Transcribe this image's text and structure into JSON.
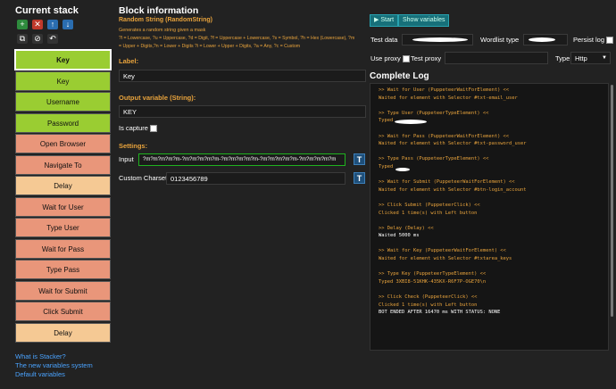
{
  "stack": {
    "title": "Current stack",
    "toolbar": [
      {
        "name": "add-icon",
        "glyph": "+",
        "color": "#2e8b3d"
      },
      {
        "name": "delete-icon",
        "glyph": "✕",
        "color": "#c0392b"
      },
      {
        "name": "move-up-icon",
        "glyph": "↑",
        "color": "#2a6db0"
      },
      {
        "name": "move-down-icon",
        "glyph": "↓",
        "color": "#2a6db0"
      },
      {
        "name": "copy-icon",
        "glyph": "⧉",
        "color": "#333"
      },
      {
        "name": "disable-icon",
        "glyph": "⊘",
        "color": "#333"
      },
      {
        "name": "undo-icon",
        "glyph": "↶",
        "color": "#333"
      }
    ],
    "items": [
      {
        "label": "Key",
        "color": "green",
        "selected": true
      },
      {
        "label": "Key",
        "color": "green"
      },
      {
        "label": "Username",
        "color": "green"
      },
      {
        "label": "Password",
        "color": "green"
      },
      {
        "label": "Open Browser",
        "color": "salmon"
      },
      {
        "label": "Navigate To",
        "color": "salmon"
      },
      {
        "label": "Delay",
        "color": "peach"
      },
      {
        "label": "Wait for User",
        "color": "salmon"
      },
      {
        "label": "Type User",
        "color": "salmon"
      },
      {
        "label": "Wait for Pass",
        "color": "salmon"
      },
      {
        "label": "Type Pass",
        "color": "salmon"
      },
      {
        "label": "Wait for Submit",
        "color": "salmon"
      },
      {
        "label": "Click Submit",
        "color": "salmon"
      },
      {
        "label": "Delay",
        "color": "peach"
      }
    ],
    "links": [
      "What is Stacker?",
      "The new variables system",
      "Default variables"
    ]
  },
  "block": {
    "title": "Block information",
    "subtitle": "Random String (RandomString)",
    "desc1": "Generates a random string given a mask",
    "desc2": "?l = Lowercase, ?u = Uppercase, ?d = Digit, ?f = Uppercase + Lowercase, ?s = Symbol, ?h = Hex (Lowercase), ?m",
    "desc3": "= Upper + Digits,?n = Lower + Digits ?i = Lower + Upper + Digits, ?a = Any, ?c = Custom",
    "label_heading": "Label:",
    "label_value": "Key",
    "output_heading": "Output variable (String):",
    "output_value": "KEY",
    "is_capture": "Is capture",
    "settings_heading": "Settings:",
    "input_label": "Input",
    "input_value": "?m?m?m?m?m-?m?m?m?m?m-?m?m?m?m?m-?m?m?m?m?m-?m?m?m?m?m",
    "charset_label": "Custom Charset",
    "charset_value": "0123456789",
    "t_button": "T"
  },
  "right": {
    "start_label": "Start",
    "show_vars_label": "Show variables",
    "test_data_label": "Test data",
    "wordlist_label": "Wordlist type",
    "persist_label": "Persist log",
    "use_proxy_label": "Use proxy",
    "test_proxy_label": "Test proxy",
    "type_label": "Type",
    "type_value": "Http",
    "log_title": "Complete Log"
  },
  "log": [
    {
      "t": ">> Wait for User (PuppeteerWaitForElement) <<",
      "c": "lo"
    },
    {
      "t": "Waited for element with Selector #txt-email_user",
      "c": "lo"
    },
    {
      "t": "",
      "c": "lo"
    },
    {
      "t": ">> Type User (PuppeteerTypeElement) <<",
      "c": "lo"
    },
    {
      "t": "Typed",
      "c": "lo"
    },
    {
      "t": "",
      "c": "lo"
    },
    {
      "t": ">> Wait for Pass (PuppeteerWaitForElement) <<",
      "c": "lo"
    },
    {
      "t": "Waited for element with Selector #txt-password_user",
      "c": "lo"
    },
    {
      "t": "",
      "c": "lo"
    },
    {
      "t": ">> Type Pass (PuppeteerTypeElement) <<",
      "c": "lo"
    },
    {
      "t": "Typed",
      "c": "lo"
    },
    {
      "t": "",
      "c": "lo"
    },
    {
      "t": ">> Wait for Submit (PuppeteerWaitForElement) <<",
      "c": "lo"
    },
    {
      "t": "Waited for element with Selector #btn-login_account",
      "c": "lo"
    },
    {
      "t": "",
      "c": "lo"
    },
    {
      "t": ">> Click Submit (PuppeteerClick) <<",
      "c": "lo"
    },
    {
      "t": "Clicked 1 time(s) with Left button",
      "c": "lo"
    },
    {
      "t": "",
      "c": "lo"
    },
    {
      "t": ">> Delay (Delay) <<",
      "c": "lo"
    },
    {
      "t": "Waited 5000 ms",
      "c": "lw"
    },
    {
      "t": "",
      "c": "lo"
    },
    {
      "t": ">> Wait for Key (PuppeteerWaitForElement) <<",
      "c": "lo"
    },
    {
      "t": "Waited for element with Selector #txtarea_keys",
      "c": "lo"
    },
    {
      "t": "",
      "c": "lo"
    },
    {
      "t": ">> Type Key (PuppeteerTypeElement) <<",
      "c": "lo"
    },
    {
      "t": "Typed 3XBI8-51KHK-435KX-R6F7P-OGE70\\n",
      "c": "lo"
    },
    {
      "t": "",
      "c": "lo"
    },
    {
      "t": ">> Click Check (PuppeteerClick) <<",
      "c": "lo"
    },
    {
      "t": "Clicked 1 time(s) with Left button",
      "c": "lo"
    },
    {
      "t": "BOT ENDED AFTER 16470 ms WITH STATUS: NONE",
      "c": "lw"
    }
  ]
}
